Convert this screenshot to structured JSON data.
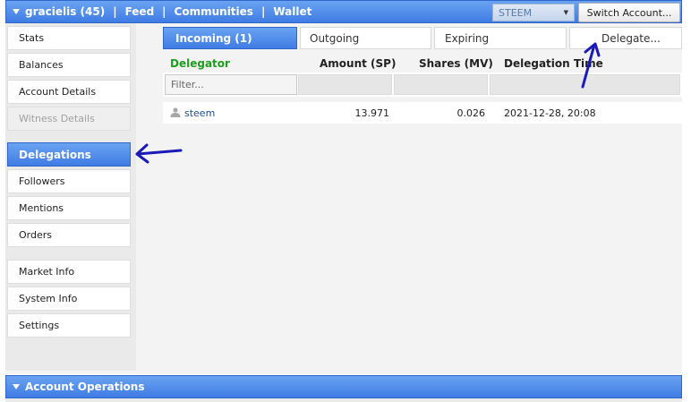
{
  "top_bar": {
    "account": "gracielis (45)",
    "links": [
      "Feed",
      "Communities",
      "Wallet"
    ],
    "separator": "|",
    "account_select": "STEEM",
    "switch_button": "Switch Account..."
  },
  "sidebar": {
    "items": [
      "Stats",
      "Balances",
      "Account Details",
      "Witness Details",
      "Delegations",
      "Followers",
      "Mentions",
      "Orders",
      "Market Info",
      "System Info",
      "Settings"
    ],
    "active": "Delegations",
    "disabled": "Witness Details"
  },
  "tabs": [
    "Incoming (1)",
    "Outgoing",
    "Expiring",
    "Delegate..."
  ],
  "table": {
    "headers": [
      "Delegator",
      "Amount (SP)",
      "Shares (MV)",
      "Delegation Time"
    ],
    "filter_placeholder": "Filter...",
    "rows": [
      {
        "delegator": "steem",
        "amount": "13.971",
        "shares": "0.026",
        "time": "2021-12-28, 20:08"
      }
    ]
  },
  "bottom_bar": {
    "title": "Account Operations"
  },
  "colors": {
    "accent": "#3f7ce4",
    "header_green": "#1e9e1e",
    "annotation_arrow": "#1a1ab8"
  },
  "icons": {
    "collapse": "triangle-down-icon",
    "user": "user-icon",
    "dropdown": "chevron-down-icon"
  }
}
